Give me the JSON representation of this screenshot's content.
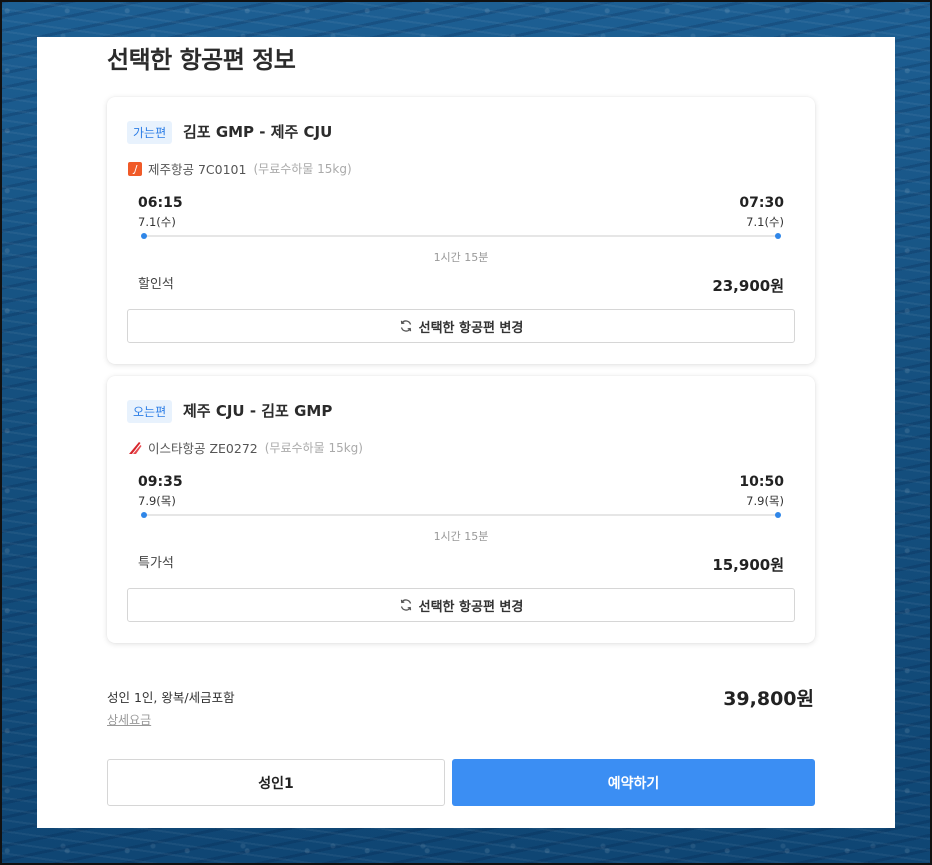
{
  "page": {
    "title": "선택한 항공편 정보"
  },
  "colors": {
    "accent": "#3b8ef3",
    "badge_bg": "#e8f2fd",
    "timeline_dot": "#2f86e8"
  },
  "flights": [
    {
      "badge": "가는편",
      "route": "김포 GMP - 제주 CJU",
      "airline": "제주항공 7C0101",
      "airline_icon": "jeju-air-logo-icon",
      "baggage": "(무료수하물 15kg)",
      "departure": {
        "time": "06:15",
        "date": "7.1(수)"
      },
      "arrival": {
        "time": "07:30",
        "date": "7.1(수)"
      },
      "duration": "1시간 15분",
      "seat_class": "할인석",
      "price": "23,900원",
      "change_label": "선택한 항공편 변경"
    },
    {
      "badge": "오는편",
      "route": "제주 CJU - 김포 GMP",
      "airline": "이스타항공 ZE0272",
      "airline_icon": "eastar-jet-logo-icon",
      "baggage": "(무료수하물 15kg)",
      "departure": {
        "time": "09:35",
        "date": "7.9(목)"
      },
      "arrival": {
        "time": "10:50",
        "date": "7.9(목)"
      },
      "duration": "1시간 15분",
      "seat_class": "특가석",
      "price": "15,900원",
      "change_label": "선택한 항공편 변경"
    }
  ],
  "summary": {
    "label": "성인 1인, 왕복/세금포함",
    "detail_link": "상세요금",
    "total": "39,800원"
  },
  "actions": {
    "passenger_label": "성인1",
    "book_label": "예약하기"
  }
}
